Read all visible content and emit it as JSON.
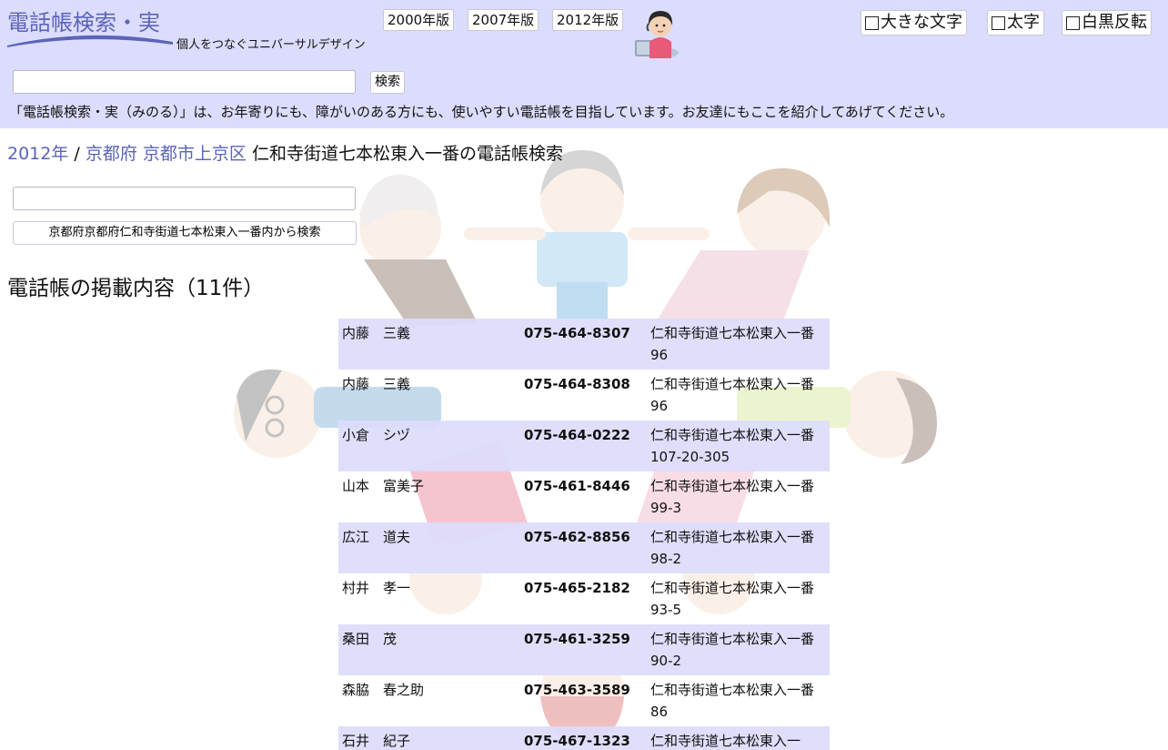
{
  "header": {
    "logo_title": "電話帳検索・実",
    "tagline": "個人をつなぐユニバーサルデザイン",
    "editions": [
      "2000年版",
      "2007年版",
      "2012年版"
    ],
    "options": [
      "大きな文字",
      "太字",
      "白黒反転"
    ],
    "search_button": "検索",
    "intro": "「電話帳検索・実（みのる）」は、お年寄りにも、障がいのある方にも、使いやすい電話帳を目指しています。お友達にもここを紹介してあげてください。"
  },
  "breadcrumb": {
    "year": "2012年",
    "separator": " / ",
    "prefecture": "京都府",
    "city": "京都市上京区",
    "current": "仁和寺街道七本松東入一番の電話帳検索"
  },
  "area_search": {
    "button": "京都府京都府仁和寺街道七本松東入一番内から検索"
  },
  "listing_heading": "電話帳の掲載内容（11件）",
  "listings": [
    {
      "surname": "内藤",
      "given": "三義",
      "phone": "075-464-8307",
      "address": "仁和寺街道七本松東入一番96"
    },
    {
      "surname": "内藤",
      "given": "三義",
      "phone": "075-464-8308",
      "address": "仁和寺街道七本松東入一番96"
    },
    {
      "surname": "小倉",
      "given": "シヅ",
      "phone": "075-464-0222",
      "address": "仁和寺街道七本松東入一番107-20-305"
    },
    {
      "surname": "山本",
      "given": "富美子",
      "phone": "075-461-8446",
      "address": "仁和寺街道七本松東入一番99-3"
    },
    {
      "surname": "広江",
      "given": "道夫",
      "phone": "075-462-8856",
      "address": "仁和寺街道七本松東入一番98-2"
    },
    {
      "surname": "村井",
      "given": "孝一",
      "phone": "075-465-2182",
      "address": "仁和寺街道七本松東入一番93-5"
    },
    {
      "surname": "桑田",
      "given": "茂",
      "phone": "075-461-3259",
      "address": "仁和寺街道七本松東入一番90-2"
    },
    {
      "surname": "森脇",
      "given": "春之助",
      "phone": "075-463-3589",
      "address": "仁和寺街道七本松東入一番86"
    },
    {
      "surname": "石井",
      "given": "紀子",
      "phone": "075-467-1323",
      "address": "仁和寺街道七本松東入一"
    }
  ],
  "colors": {
    "header_bg": "#dcdcfc",
    "link": "#5b64b8",
    "row_stripe": "#dcdcfc"
  }
}
